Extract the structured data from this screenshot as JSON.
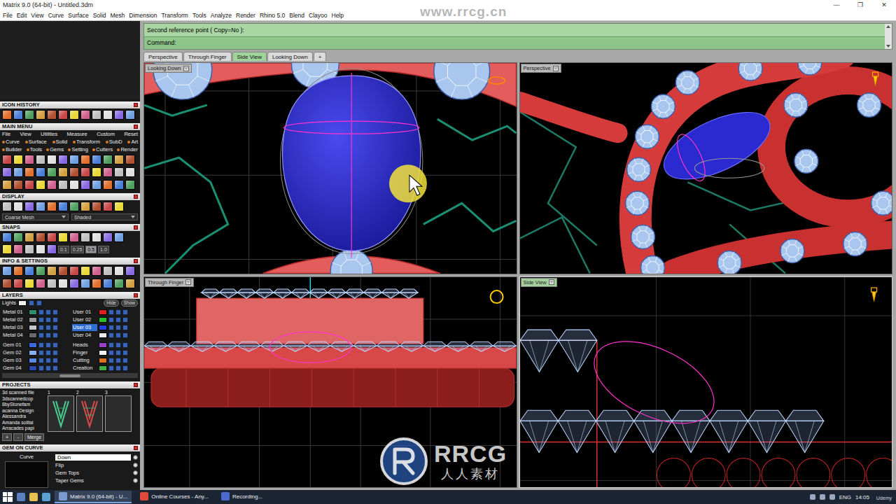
{
  "window": {
    "title": "Matrix 9.0 (64-bit) - Untitled.3dm",
    "controls": [
      "—",
      "❐",
      "✕"
    ]
  },
  "menu": [
    "File",
    "Edit",
    "View",
    "Curve",
    "Surface",
    "Solid",
    "Mesh",
    "Dimension",
    "Transform",
    "Tools",
    "Analyze",
    "Render",
    "Rhino 5.0",
    "Blend",
    "Clayoo",
    "Help"
  ],
  "command": {
    "history": "Second reference point ( Copy=No ):",
    "prompt": "Command:"
  },
  "tabs": [
    {
      "label": "Perspective",
      "selected": false
    },
    {
      "label": "Through Finger",
      "selected": false
    },
    {
      "label": "Side View",
      "selected": true
    },
    {
      "label": "Looking Down",
      "selected": false
    },
    {
      "label": "+",
      "selected": false
    }
  ],
  "viewports": [
    {
      "title": "Looking Down",
      "kind": "top",
      "active": false
    },
    {
      "title": "Perspective",
      "kind": "perspective",
      "active": false
    },
    {
      "title": "Through Finger",
      "kind": "front",
      "active": false
    },
    {
      "title": "Side View",
      "kind": "side",
      "active": true
    }
  ],
  "sidebar": {
    "iconHistory": {
      "title": "ICON HISTORY"
    },
    "mainMenu": {
      "title": "MAIN MENU",
      "rows": [
        [
          "File",
          "View",
          "Utilities",
          "Measure",
          "Custom",
          "Reset"
        ],
        [
          "Curve",
          "Surface",
          "Solid",
          "Transform",
          "SubD",
          "Art"
        ],
        [
          "Builder",
          "Tools",
          "Gems",
          "Setting",
          "Cutters",
          "Render"
        ]
      ]
    },
    "display": {
      "title": "DISPLAY",
      "mesh": "Coarse Mesh",
      "shade": "Shaded"
    },
    "snaps": {
      "title": "SNAPS",
      "steps": [
        {
          "label": "0.1",
          "selected": false
        },
        {
          "label": "0.25",
          "selected": false
        },
        {
          "label": "0.5",
          "selected": true
        },
        {
          "label": "1.0",
          "selected": false
        }
      ]
    },
    "info": {
      "title": "INFO & SETTINGS"
    },
    "layers": {
      "title": "LAYERS",
      "lights": "Lights",
      "hide": "Hide",
      "show": "Show",
      "groups": [
        [
          {
            "name": "Metal 01",
            "color": "#2f8f6a",
            "selected": false
          },
          {
            "name": "User 01",
            "color": "#e02020",
            "selected": false
          },
          {
            "name": "Metal 02",
            "color": "#9a9a9a",
            "selected": false
          },
          {
            "name": "User 02",
            "color": "#28c028",
            "selected": false
          },
          {
            "name": "Metal 03",
            "color": "#c8c8c8",
            "selected": false
          },
          {
            "name": "User 03",
            "color": "#2040e0",
            "selected": true
          },
          {
            "name": "Metal 04",
            "color": "#6a6a6a",
            "selected": false
          },
          {
            "name": "User 04",
            "color": "#e8e8e8",
            "selected": false
          }
        ],
        [
          {
            "name": "Gem 01",
            "color": "#3a6ad8",
            "selected": false
          },
          {
            "name": "Heads",
            "color": "#9a40c8",
            "selected": false
          },
          {
            "name": "Gem 02",
            "color": "#8ab0e8",
            "selected": false
          },
          {
            "name": "Finger",
            "color": "#f0f0f0",
            "selected": false
          },
          {
            "name": "Gem 03",
            "color": "#5a8ae0",
            "selected": false
          },
          {
            "name": "Cutting",
            "color": "#e07020",
            "selected": false
          },
          {
            "name": "Gem 04",
            "color": "#2a4ab0",
            "selected": false
          },
          {
            "name": "Creation",
            "color": "#40b040",
            "selected": false
          }
        ]
      ]
    },
    "projects": {
      "title": "PROJECTS",
      "files": [
        "3d scanned file",
        "3dscannedcop",
        "8byStonefam",
        "acanna Design",
        "Alessandra",
        "Amanda solitai",
        "Arracades papi"
      ],
      "thumbs": [
        "1",
        "2",
        "3"
      ],
      "buttons": [
        "+",
        "-",
        "Merge"
      ]
    },
    "gemOnCurve": {
      "title": "GEM ON CURVE",
      "curve": "Curve",
      "options": [
        {
          "label": "Down",
          "kind": "field"
        },
        {
          "label": "Flip",
          "kind": "radio"
        },
        {
          "label": "Gem Tops",
          "kind": "radio"
        },
        {
          "label": "Taper Gems",
          "kind": "radio"
        }
      ]
    }
  },
  "taskbar": {
    "items": [
      {
        "label": "Matrix 9.0 (64-bit) - U...",
        "selected": true
      },
      {
        "label": "Online Courses - Any...",
        "selected": false
      },
      {
        "label": "Recording...",
        "selected": false
      }
    ],
    "language": "ENG",
    "time": "14:05"
  },
  "watermark": {
    "site": "www.rrcg.cn",
    "brand": "RRCG",
    "subtitle": "人人素材",
    "corner": "Udemy"
  }
}
